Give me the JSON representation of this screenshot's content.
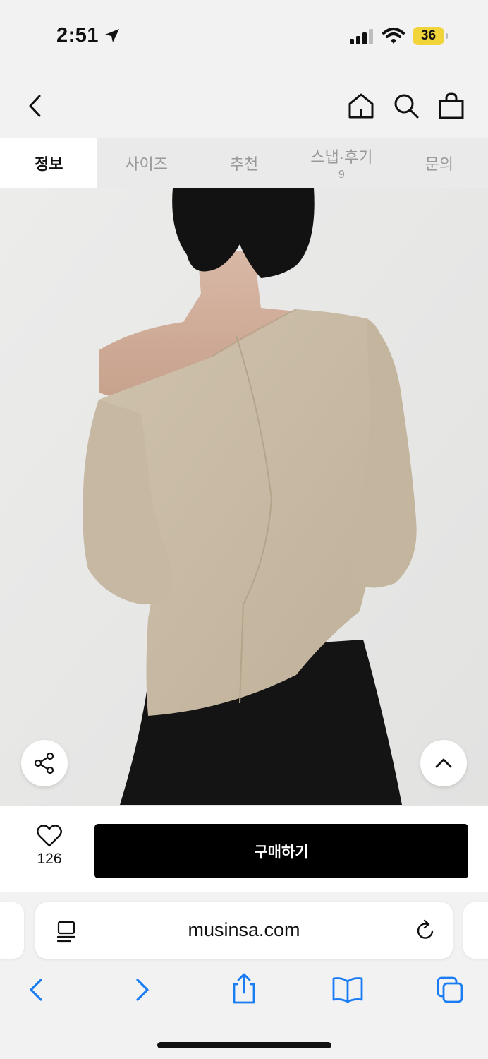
{
  "status_bar": {
    "time": "2:51",
    "battery": "36"
  },
  "tabs": [
    {
      "label": "정보",
      "active": true,
      "count": ""
    },
    {
      "label": "사이즈",
      "active": false,
      "count": ""
    },
    {
      "label": "추천",
      "active": false,
      "count": ""
    },
    {
      "label": "스냅·후기",
      "active": false,
      "count": "9"
    },
    {
      "label": "문의",
      "active": false,
      "count": ""
    }
  ],
  "buy_bar": {
    "like_count": "126",
    "buy_label": "구매하기"
  },
  "browser": {
    "url": "musinsa.com"
  },
  "colors": {
    "buy_button": "#000000",
    "battery": "#f0d43a",
    "toolbar_accent": "#1a7cf5",
    "top_beige": "#c9bba5"
  },
  "icons": [
    "location-arrow-icon",
    "signal-icon",
    "wifi-icon",
    "back-icon",
    "home-icon",
    "search-icon",
    "bag-icon",
    "share-icon",
    "scroll-top-icon",
    "heart-icon",
    "reader-icon",
    "reload-icon",
    "browser-back-icon",
    "browser-forward-icon",
    "browser-share-icon",
    "bookmarks-icon",
    "tabs-icon"
  ]
}
